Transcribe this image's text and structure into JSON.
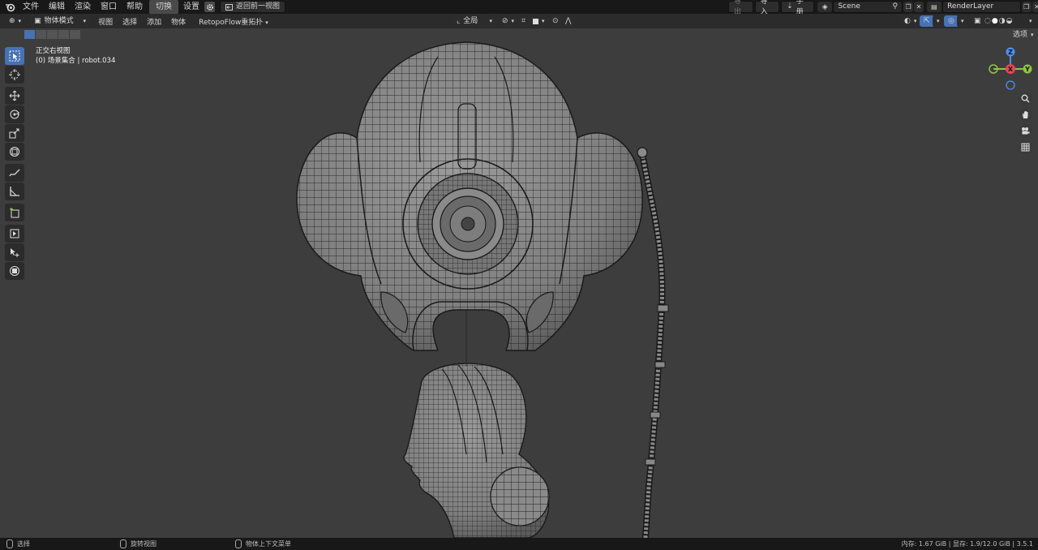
{
  "topbar": {
    "menu": [
      "文件",
      "编辑",
      "渲染",
      "窗口",
      "帮助"
    ],
    "workspace_tab": "切换",
    "settings_label": "设置",
    "back_button": "返回前一视图",
    "export_label": "导出",
    "import_label": "导入",
    "manual_label": "手册",
    "scene_name": "Scene",
    "render_layer": "RenderLayer"
  },
  "header": {
    "mode": "物体模式",
    "menus": [
      "视图",
      "选择",
      "添加",
      "物体"
    ],
    "addon_menu": "RetopoFlow重拓扑",
    "transform_orientation": "全局",
    "options_label": "选项"
  },
  "viewport": {
    "view_name": "正交右视图",
    "collection_info": "(0) 场景集合 | robot.034",
    "gizmo_axes": [
      "Z",
      "X",
      "Y"
    ]
  },
  "statusbar": {
    "select": "选择",
    "rotate_view": "旋转视图",
    "context_menu": "物体上下文菜单",
    "stats": "内存: 1.67 GiB | 显存: 1.9/12.0 GiB | 3.5.1"
  },
  "colors": {
    "accent": "#4772b3",
    "x_axis": "#e74653",
    "y_axis": "#8ec63f",
    "z_axis": "#4c8ef4"
  }
}
